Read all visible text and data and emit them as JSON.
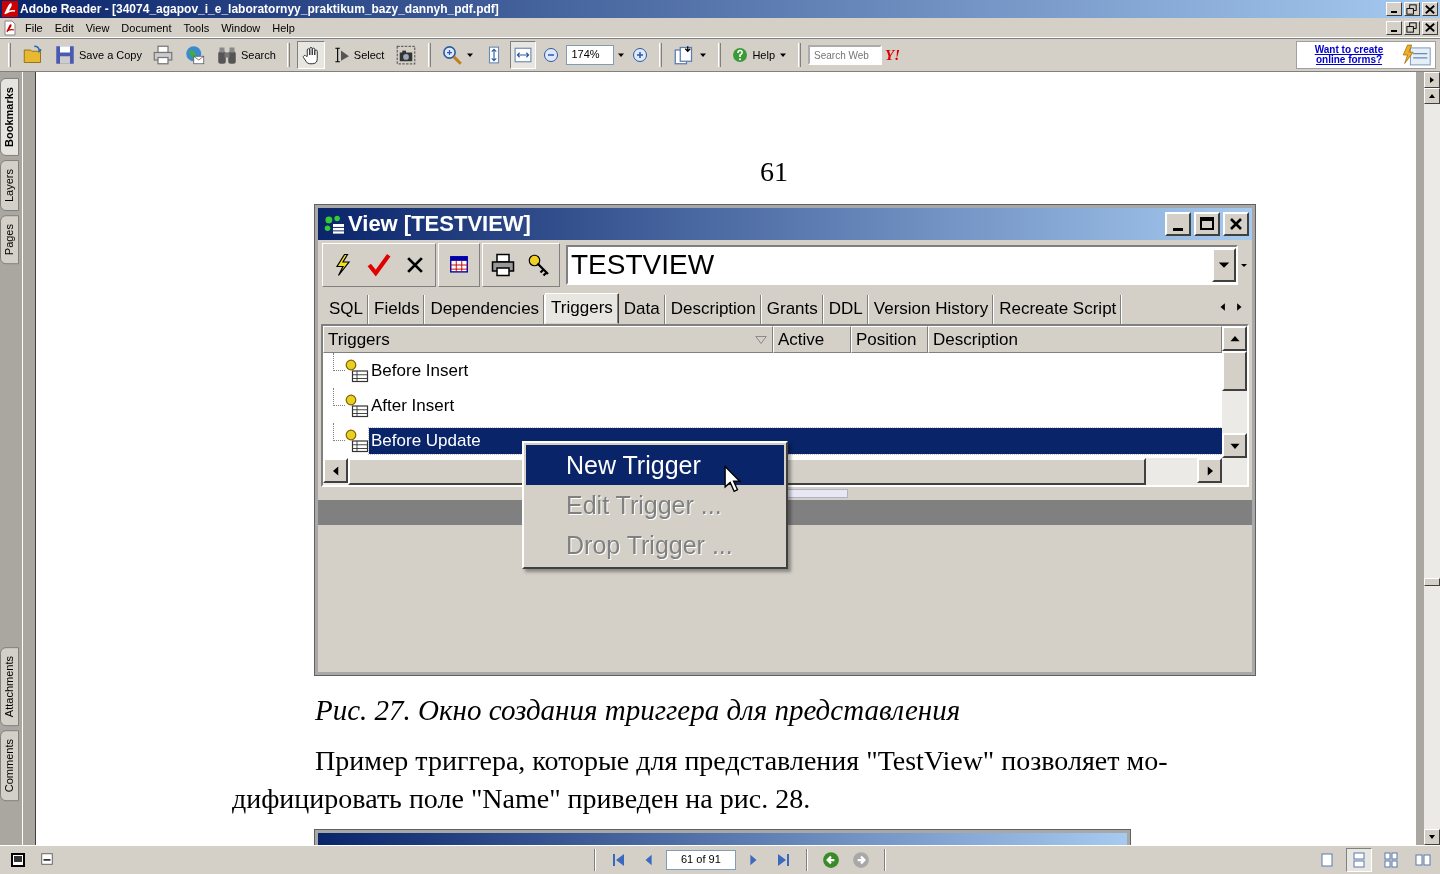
{
  "window": {
    "title": "Adobe Reader - [34074_agapov_i_e_laboratornyy_praktikum_bazy_dannyh_pdf.pdf]"
  },
  "menu": [
    "File",
    "Edit",
    "View",
    "Document",
    "Tools",
    "Window",
    "Help"
  ],
  "toolbar": {
    "save_label": "Save a Copy",
    "search_label": "Search",
    "tools": [
      {
        "kind": "hand",
        "selected": true
      },
      {
        "kind": "select",
        "label": "Select",
        "selected": false
      },
      {
        "kind": "snapshot",
        "selected": false
      }
    ],
    "fit": [
      {
        "kind": "fit-page",
        "selected": false
      },
      {
        "kind": "fit-width",
        "selected": true
      }
    ],
    "zoom": "174%",
    "help_label": "Help",
    "web_search": {
      "placeholder": "Search Web"
    },
    "search_logo": "Y!",
    "promo_link": "Want to create online forms?"
  },
  "side_tabs_top": [
    {
      "label": "Bookmarks",
      "selected": true
    },
    {
      "label": "Layers",
      "selected": false
    },
    {
      "label": "Pages",
      "selected": false
    }
  ],
  "side_tabs_bottom": [
    {
      "label": "Attachments",
      "selected": false
    },
    {
      "label": "Comments",
      "selected": false
    }
  ],
  "page": {
    "page_number": "61",
    "figure": {
      "title": "View [TESTVIEW]",
      "object_name": "TESTVIEW",
      "tabs": [
        {
          "label": "SQL",
          "selected": false
        },
        {
          "label": "Fields",
          "selected": false
        },
        {
          "label": "Dependencies",
          "selected": false
        },
        {
          "label": "Triggers",
          "selected": true
        },
        {
          "label": "Data",
          "selected": false
        },
        {
          "label": "Description",
          "selected": false
        },
        {
          "label": "Grants",
          "selected": false
        },
        {
          "label": "DDL",
          "selected": false
        },
        {
          "label": "Version History",
          "selected": false
        },
        {
          "label": "Recreate Script",
          "selected": false
        }
      ],
      "columns": [
        "Triggers",
        "Active",
        "Position",
        "Description"
      ],
      "rows": [
        {
          "label": "Before Insert",
          "selected": false
        },
        {
          "label": "After Insert",
          "selected": false
        },
        {
          "label": "Before Update",
          "selected": true
        }
      ],
      "context_menu": [
        {
          "label": "New Trigger",
          "selected": true,
          "disabled": false
        },
        {
          "label": "Edit Trigger ...",
          "selected": false,
          "disabled": true
        },
        {
          "label": "Drop Trigger ...",
          "selected": false,
          "disabled": true
        }
      ]
    },
    "caption": "Рис. 27. Окно создания триггера для представления",
    "paragraph_lines": [
      "Пример триггера, которые для представления \"TestView\" позволяет мо-",
      "дифицировать поле \"Name\" приведен на рис. 28."
    ]
  },
  "status_bar": {
    "page_field": "61 of 91",
    "nav": [
      {
        "kind": "back",
        "disabled": false
      },
      {
        "kind": "forward",
        "disabled": true
      }
    ],
    "views": [
      {
        "kind": "single",
        "selected": false
      },
      {
        "kind": "continuous",
        "selected": true
      },
      {
        "kind": "continuous-facing",
        "selected": false
      },
      {
        "kind": "facing",
        "selected": false
      }
    ]
  }
}
